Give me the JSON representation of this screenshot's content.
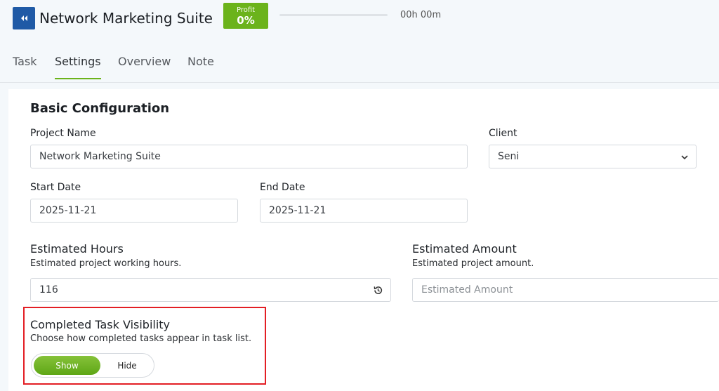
{
  "header": {
    "back_icon": "double-chevron-left-icon",
    "title": "Network Marketing Suite",
    "profit_label": "Profit",
    "profit_value": "0%",
    "progress": 0,
    "time": "00h 00m",
    "accent_color": "#6bb31b",
    "brand_color": "#1f5aa6"
  },
  "tabs": [
    {
      "label": "Task",
      "active": false
    },
    {
      "label": "Settings",
      "active": true
    },
    {
      "label": "Overview",
      "active": false
    },
    {
      "label": "Note",
      "active": false
    }
  ],
  "basic": {
    "title": "Basic Configuration",
    "project_name_label": "Project Name",
    "project_name_value": "Network Marketing Suite",
    "client_label": "Client",
    "client_value": "Seni",
    "start_date_label": "Start Date",
    "start_date_value": "2025-11-21",
    "end_date_label": "End Date",
    "end_date_value": "2025-11-21",
    "est_hours_label": "Estimated Hours",
    "est_hours_help": "Estimated project working hours.",
    "est_hours_value": "116",
    "est_amount_label": "Estimated Amount",
    "est_amount_help": "Estimated project amount.",
    "est_amount_placeholder": "Estimated Amount"
  },
  "visibility": {
    "title": "Completed Task Visibility",
    "help": "Choose how completed tasks appear in task list.",
    "show_label": "Show",
    "hide_label": "Hide",
    "selected": "Show",
    "highlight_color": "#e31e24"
  }
}
